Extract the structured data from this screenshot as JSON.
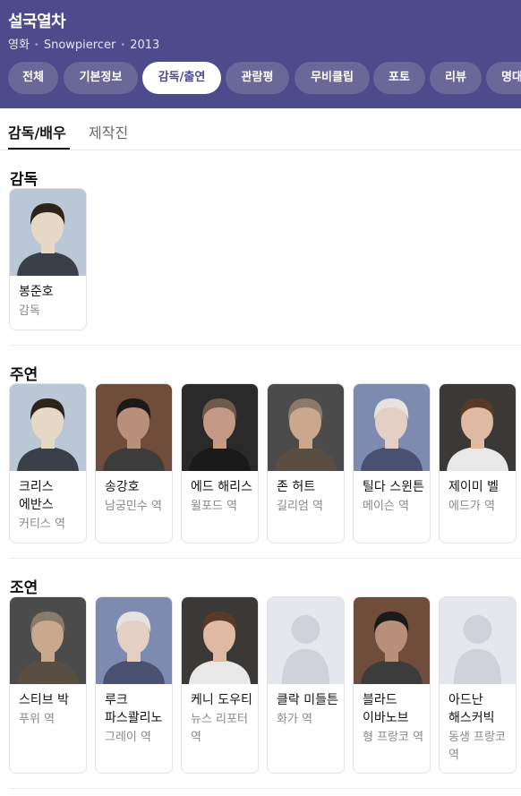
{
  "header": {
    "title": "설국열차",
    "meta": [
      "영화",
      "Snowpiercer",
      "2013"
    ]
  },
  "tabs": [
    {
      "label": "전체",
      "active": false
    },
    {
      "label": "기본정보",
      "active": false
    },
    {
      "label": "감독/출연",
      "active": true
    },
    {
      "label": "관람평",
      "active": false
    },
    {
      "label": "무비클립",
      "active": false
    },
    {
      "label": "포토",
      "active": false
    },
    {
      "label": "리뷰",
      "active": false
    },
    {
      "label": "명대사",
      "active": false
    }
  ],
  "subtabs": [
    {
      "label": "감독/배우",
      "active": true
    },
    {
      "label": "제작진",
      "active": false
    }
  ],
  "sections": {
    "director": {
      "title": "감독",
      "people": [
        {
          "name": "봉준호",
          "role": "감독",
          "photo": "person-photo"
        }
      ]
    },
    "leads": {
      "title": "주연",
      "people": [
        {
          "name": "크리스 에반스",
          "role": "커티스 역",
          "photo": "person-photo"
        },
        {
          "name": "송강호",
          "role": "남궁민수 역",
          "photo": "person-photo"
        },
        {
          "name": "에드 해리스",
          "role": "윌포드 역",
          "photo": "person-photo"
        },
        {
          "name": "존 허트",
          "role": "길리엄 역",
          "photo": "person-photo"
        },
        {
          "name": "틸다 스윈튼",
          "role": "메이슨 역",
          "photo": "person-photo"
        },
        {
          "name": "제이미 벨",
          "role": "에드가 역",
          "photo": "person-photo"
        }
      ]
    },
    "supporting": {
      "title": "조연",
      "people": [
        {
          "name": "스티브 박",
          "role": "푸위 역",
          "photo": "person-photo"
        },
        {
          "name": "루크 파스콸리노",
          "role": "그레이 역",
          "photo": "person-photo"
        },
        {
          "name": "케니 도우티",
          "role": "뉴스 리포터 역",
          "photo": "person-photo"
        },
        {
          "name": "클락 미들튼",
          "role": "화가 역",
          "photo": "placeholder-avatar"
        },
        {
          "name": "블라드 이바노브",
          "role": "형 프랑코 역",
          "photo": "person-photo"
        },
        {
          "name": "아드난 해스커빅",
          "role": "동생 프랑코 역",
          "photo": "placeholder-avatar"
        }
      ]
    }
  },
  "colors": {
    "header_bg": "#4d4b8c",
    "tab_bg": "#6a6898",
    "tab_active_bg": "#ffffff",
    "tab_active_text": "#4d4b8c"
  }
}
